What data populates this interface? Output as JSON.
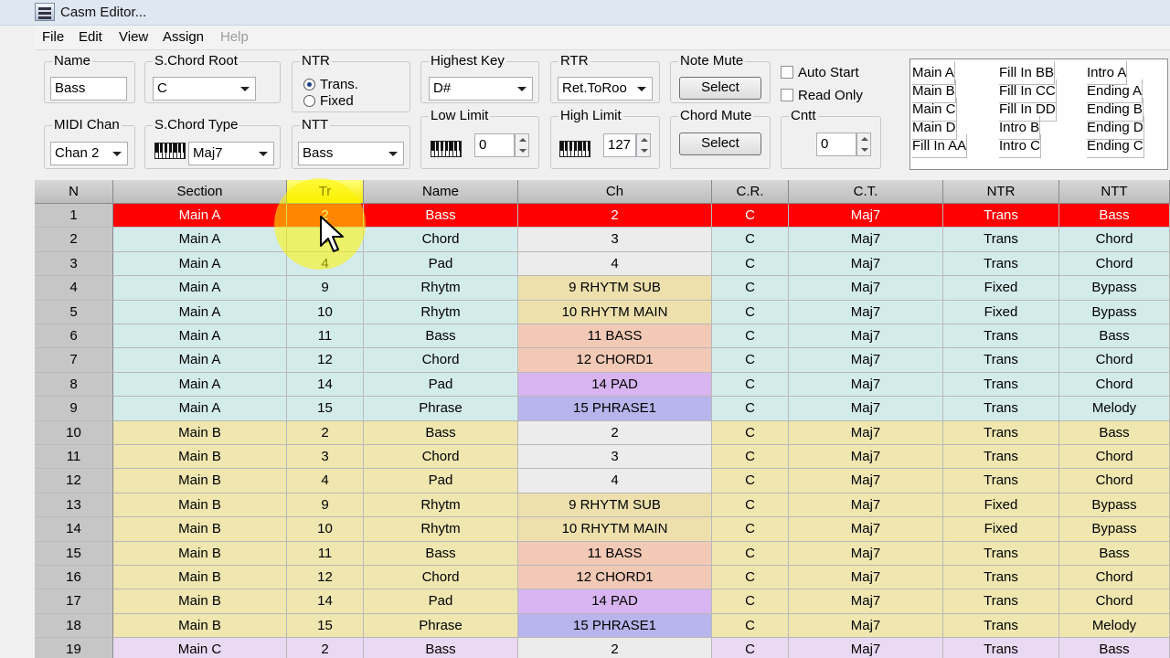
{
  "window": {
    "title": "Casm Editor..."
  },
  "menu": [
    "File",
    "Edit",
    "View",
    "Assign",
    "Help"
  ],
  "controls": {
    "name": {
      "label": "Name",
      "value": "Bass"
    },
    "schord_root": {
      "label": "S.Chord Root",
      "value": "C"
    },
    "ntr": {
      "label": "NTR",
      "options": [
        "Trans.",
        "Fixed"
      ],
      "selected": "Trans."
    },
    "highest_key": {
      "label": "Highest Key",
      "value": "D#"
    },
    "rtr": {
      "label": "RTR",
      "value": "Ret.ToRoo"
    },
    "note_mute": {
      "label": "Note Mute",
      "button": "Select"
    },
    "auto_start": {
      "label": "Auto Start",
      "checked": false
    },
    "read_only": {
      "label": "Read Only",
      "checked": false
    },
    "midi_chan": {
      "label": "MIDI Chan",
      "value": "Chan 2"
    },
    "schord_type": {
      "label": "S.Chord Type",
      "value": "Maj7"
    },
    "ntt": {
      "label": "NTT",
      "value": "Bass"
    },
    "low_limit": {
      "label": "Low Limit",
      "value": "0"
    },
    "high_limit": {
      "label": "High Limit",
      "value": "127"
    },
    "chord_mute": {
      "label": "Chord Mute",
      "button": "Select"
    },
    "cntt": {
      "label": "Cntt",
      "value": "0"
    }
  },
  "sections_list": [
    [
      "Main A",
      "Fill In BB",
      "Intro A"
    ],
    [
      "Main B",
      "Fill In CC",
      "Ending A"
    ],
    [
      "Main C",
      "Fill In DD",
      "Ending B"
    ],
    [
      "Main D",
      "Intro B",
      "Ending D"
    ],
    [
      "Fill In AA",
      "Intro C",
      "Ending C"
    ]
  ],
  "table": {
    "columns": [
      "N",
      "Section",
      "Tr",
      "Name",
      "Ch",
      "C.R.",
      "C.T.",
      "NTR",
      "NTT"
    ],
    "active_column": "Tr",
    "selected_row": 1,
    "rows": [
      [
        "1",
        "Main A",
        "2",
        "Bass",
        "2",
        "C",
        "Maj7",
        "Trans",
        "Bass"
      ],
      [
        "2",
        "Main A",
        "3",
        "Chord",
        "3",
        "C",
        "Maj7",
        "Trans",
        "Chord"
      ],
      [
        "3",
        "Main A",
        "4",
        "Pad",
        "4",
        "C",
        "Maj7",
        "Trans",
        "Chord"
      ],
      [
        "4",
        "Main A",
        "9",
        "Rhytm",
        "9  RHYTM SUB",
        "C",
        "Maj7",
        "Fixed",
        "Bypass"
      ],
      [
        "5",
        "Main A",
        "10",
        "Rhytm",
        "10  RHYTM MAIN",
        "C",
        "Maj7",
        "Fixed",
        "Bypass"
      ],
      [
        "6",
        "Main A",
        "11",
        "Bass",
        "11  BASS",
        "C",
        "Maj7",
        "Trans",
        "Bass"
      ],
      [
        "7",
        "Main A",
        "12",
        "Chord",
        "12  CHORD1",
        "C",
        "Maj7",
        "Trans",
        "Chord"
      ],
      [
        "8",
        "Main A",
        "14",
        "Pad",
        "14  PAD",
        "C",
        "Maj7",
        "Trans",
        "Chord"
      ],
      [
        "9",
        "Main A",
        "15",
        "Phrase",
        "15  PHRASE1",
        "C",
        "Maj7",
        "Trans",
        "Melody"
      ],
      [
        "10",
        "Main B",
        "2",
        "Bass",
        "2",
        "C",
        "Maj7",
        "Trans",
        "Bass"
      ],
      [
        "11",
        "Main B",
        "3",
        "Chord",
        "3",
        "C",
        "Maj7",
        "Trans",
        "Chord"
      ],
      [
        "12",
        "Main B",
        "4",
        "Pad",
        "4",
        "C",
        "Maj7",
        "Trans",
        "Chord"
      ],
      [
        "13",
        "Main B",
        "9",
        "Rhytm",
        "9  RHYTM SUB",
        "C",
        "Maj7",
        "Fixed",
        "Bypass"
      ],
      [
        "14",
        "Main B",
        "10",
        "Rhytm",
        "10  RHYTM MAIN",
        "C",
        "Maj7",
        "Fixed",
        "Bypass"
      ],
      [
        "15",
        "Main B",
        "11",
        "Bass",
        "11  BASS",
        "C",
        "Maj7",
        "Trans",
        "Bass"
      ],
      [
        "16",
        "Main B",
        "12",
        "Chord",
        "12  CHORD1",
        "C",
        "Maj7",
        "Trans",
        "Chord"
      ],
      [
        "17",
        "Main B",
        "14",
        "Pad",
        "14  PAD",
        "C",
        "Maj7",
        "Trans",
        "Chord"
      ],
      [
        "18",
        "Main B",
        "15",
        "Phrase",
        "15  PHRASE1",
        "C",
        "Maj7",
        "Trans",
        "Melody"
      ],
      [
        "19",
        "Main C",
        "2",
        "Bass",
        "2",
        "C",
        "Maj7",
        "Trans",
        "Bass"
      ]
    ]
  },
  "colors": {
    "selected_row": "#ff0000",
    "main_a": "#d3eceb",
    "main_b": "#efe6b0",
    "main_c": "#ead9f3",
    "ch_plain": "#ececec",
    "ch_rhytm": "#ede0ad",
    "ch_bass_chord": "#f2c9b5",
    "ch_pad": "#d8b5f0",
    "ch_phrase": "#b8b4ec"
  }
}
